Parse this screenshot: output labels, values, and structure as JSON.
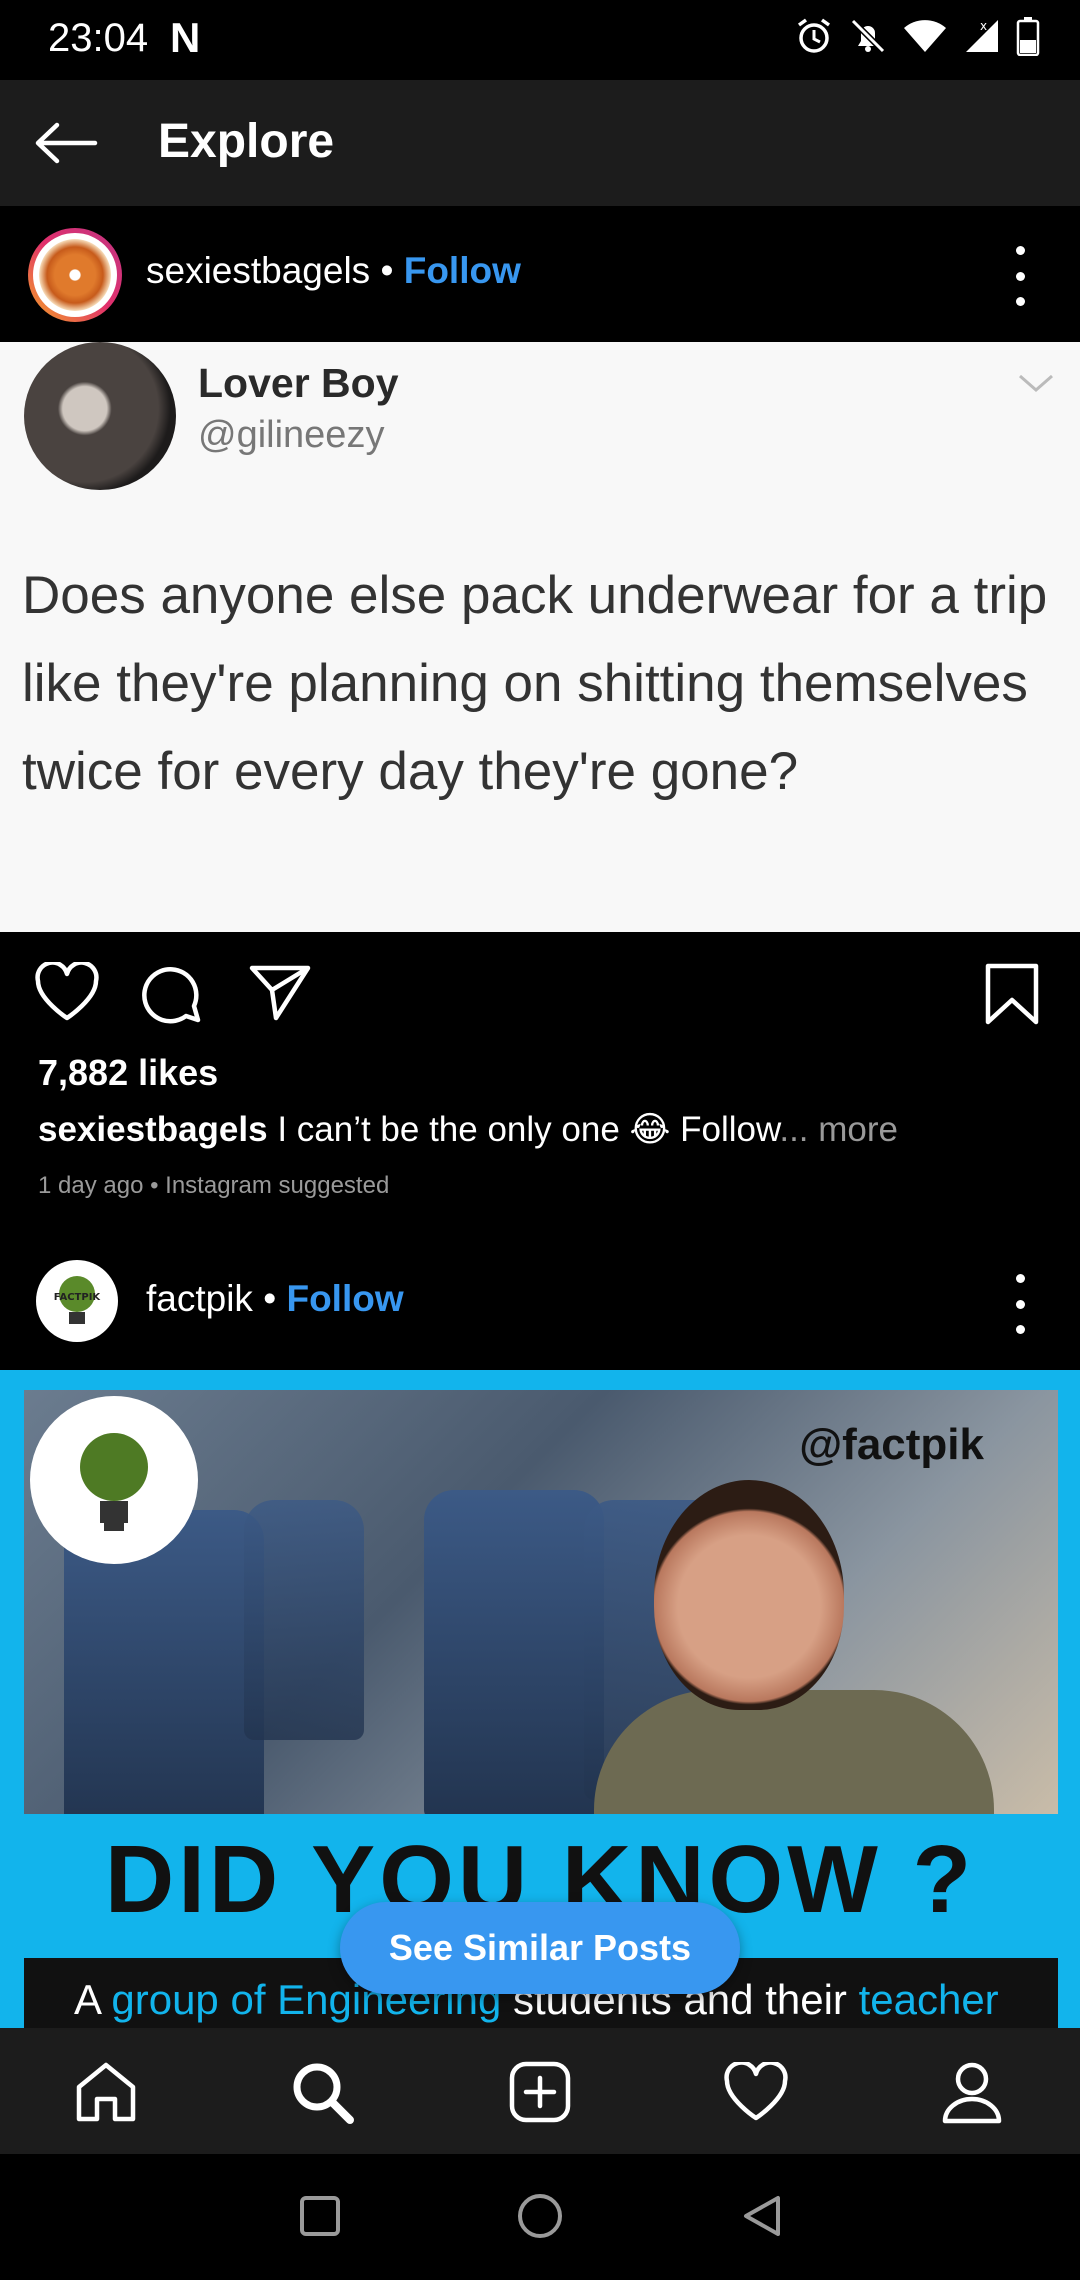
{
  "status_bar": {
    "time": "23:04",
    "notification_glyph": "N"
  },
  "header": {
    "title": "Explore"
  },
  "post1": {
    "username": "sexiestbagels",
    "separator": "•",
    "follow_label": "Follow",
    "tweet": {
      "name": "Lover Boy",
      "handle": "@gilineezy",
      "text": "Does anyone else pack underwear for a trip like they're planning on shitting themselves twice for every day they're gone?"
    },
    "likes": "7,882 likes",
    "caption_user": "sexiestbagels",
    "caption_text": "I can’t be the only one 😂 Follow",
    "caption_more": "... more",
    "meta": "1 day ago • Instagram suggested"
  },
  "post2": {
    "username": "factpik",
    "separator": "•",
    "follow_label": "Follow",
    "image": {
      "watermark": "@factpik",
      "logo_text": "FACTPIK",
      "headline": "DID YOU KNOW ?",
      "band_prefix": "A ",
      "band_highlight": "group of Engineering",
      "band_mid": " students and their ",
      "band_highlight2": "teacher"
    }
  },
  "see_similar_label": "See Similar Posts",
  "colors": {
    "accent": "#3897f0",
    "factpik_bg": "#12b4ec",
    "bar_bg": "#1c1c1c"
  }
}
